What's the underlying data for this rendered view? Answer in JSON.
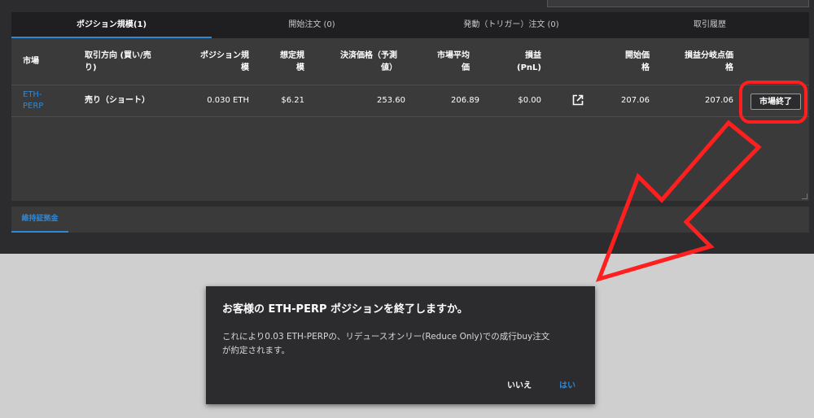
{
  "tabs": [
    {
      "label": "ポジション規模(1)",
      "active": true
    },
    {
      "label": "開始注文 (0)",
      "active": false
    },
    {
      "label": "発動（トリガー）注文 (0)",
      "active": false
    },
    {
      "label": "取引履歴",
      "active": false
    }
  ],
  "columns": {
    "market": "市場",
    "side_l1": "取引方向 (買い/売",
    "side_l2": "り)",
    "size_l1": "ポジション規",
    "size_l2": "模",
    "notional_l1": "想定規",
    "notional_l2": "模",
    "settle_l1": "決済価格（予測",
    "settle_l2": "値）",
    "mark_l1": "市場平均",
    "mark_l2": "価",
    "pnl_l1": "損益",
    "pnl_l2": "(PnL)",
    "entry_l1": "開始価",
    "entry_l2": "格",
    "breakeven_l1": "損益分岐点価",
    "breakeven_l2": "格"
  },
  "position": {
    "market_l1": "ETH-",
    "market_l2": "PERP",
    "side": "売り（ショート）",
    "size": "0.030 ETH",
    "notional": "$6.21",
    "settle_price": "253.60",
    "mark_price": "206.89",
    "pnl": "$0.00",
    "entry_price": "207.06",
    "breakeven": "207.06",
    "close_label": "市場終了"
  },
  "bottom_tab": {
    "label": "維持証拠金"
  },
  "dialog": {
    "title": "お客様の ETH-PERP ポジションを終了しますか。",
    "body_l1": "これにより0.03 ETH-PERPの、リデュースオンリー(Reduce Only)での成行buy注文",
    "body_l2": "が約定されます。",
    "no_label": "いいえ",
    "yes_label": "はい"
  },
  "colors": {
    "accent": "#2e88d8",
    "annotation_red": "#ff1f1f",
    "panel_bg": "#3a3a3a",
    "tab_bar_bg": "#1f1f21"
  },
  "icons": {
    "external_link": "external-link-icon",
    "annotation_arrow": "red-arrow-annotation"
  }
}
